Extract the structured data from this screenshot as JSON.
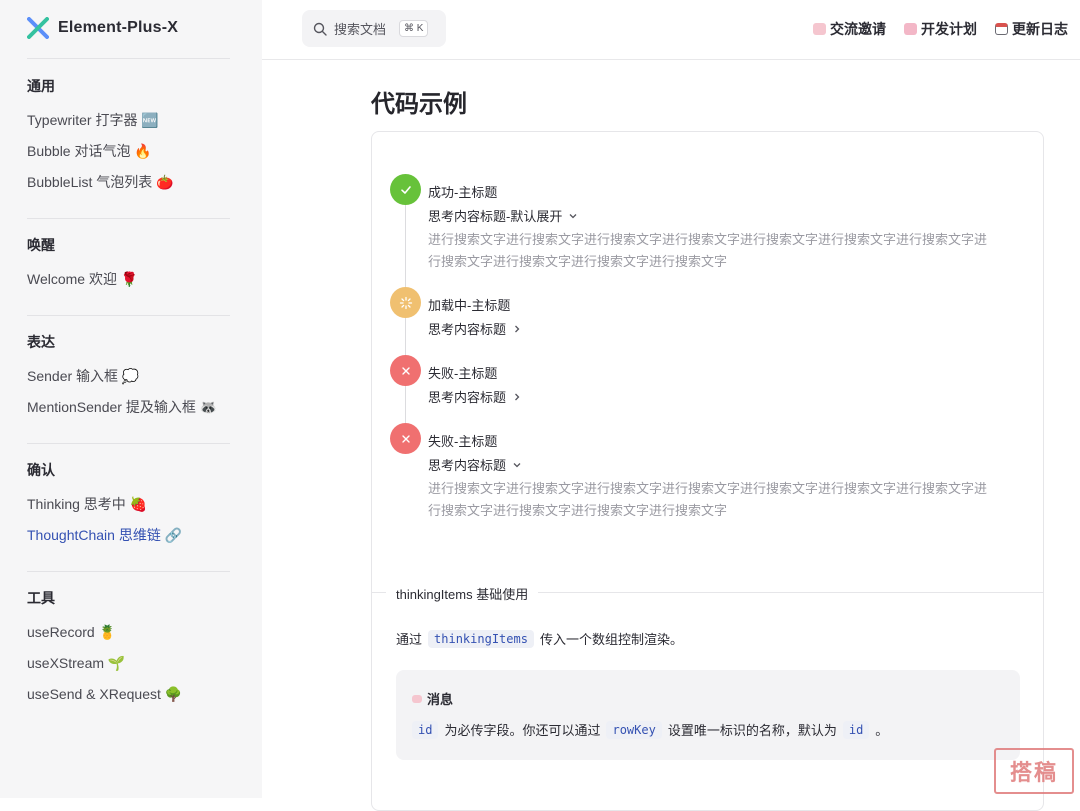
{
  "brand": {
    "name": "Element-Plus-X"
  },
  "sidebar": {
    "groups": [
      {
        "title": "通用",
        "items": [
          {
            "label": "Typewriter 打字器 🆕"
          },
          {
            "label": "Bubble 对话气泡 🔥"
          },
          {
            "label": "BubbleList 气泡列表 🍅"
          }
        ]
      },
      {
        "title": "唤醒",
        "items": [
          {
            "label": "Welcome 欢迎 🌹"
          }
        ]
      },
      {
        "title": "表达",
        "items": [
          {
            "label": "Sender 输入框 💭"
          },
          {
            "label": "MentionSender 提及输入框 🦝"
          }
        ]
      },
      {
        "title": "确认",
        "items": [
          {
            "label": "Thinking 思考中 🍓"
          },
          {
            "label": "ThoughtChain 思维链 🔗"
          }
        ]
      },
      {
        "title": "工具",
        "items": [
          {
            "label": "useRecord 🍍"
          },
          {
            "label": "useXStream 🌱"
          },
          {
            "label": "useSend & XRequest 🌳"
          }
        ]
      }
    ]
  },
  "topbar": {
    "search": {
      "label": "搜索文档",
      "shortcut": "⌘ K"
    },
    "links": [
      {
        "label": "交流邀请",
        "icon": "heart-letter-icon",
        "color": "#e05a6b"
      },
      {
        "label": "开发计划",
        "icon": "ribbon-icon",
        "color": "#e58aa0"
      },
      {
        "label": "更新日志",
        "icon": "calendar-icon",
        "color": "#6b6b73"
      }
    ]
  },
  "main": {
    "title": "代码示例",
    "colors": {
      "success": "#67c23a",
      "loading": "#f0c070",
      "error": "#f07070",
      "accent": "#3451b2"
    },
    "chain": [
      {
        "status": "success",
        "title": "成功-主标题",
        "subtitle": "思考内容标题-默认展开",
        "expanded": true,
        "content": "进行搜索文字进行搜索文字进行搜索文字进行搜索文字进行搜索文字进行搜索文字进行搜索文字进行搜索文字进行搜索文字进行搜索文字进行搜索文字"
      },
      {
        "status": "loading",
        "title": "加载中-主标题",
        "subtitle": "思考内容标题",
        "expanded": false,
        "content": ""
      },
      {
        "status": "error",
        "title": "失败-主标题",
        "subtitle": "思考内容标题",
        "expanded": false,
        "content": ""
      },
      {
        "status": "error",
        "title": "失败-主标题",
        "subtitle": "思考内容标题",
        "expanded": true,
        "content": "进行搜索文字进行搜索文字进行搜索文字进行搜索文字进行搜索文字进行搜索文字进行搜索文字进行搜索文字进行搜索文字进行搜索文字进行搜索文字"
      }
    ],
    "section_title": "thinkingItems 基础使用",
    "desc": {
      "prefix": "通过",
      "code": "thinkingItems",
      "suffix": "传入一个数组控制渲染。"
    },
    "tip": {
      "title": "消息",
      "code1": "id",
      "text1": "为必传字段。你还可以通过",
      "code2": "rowKey",
      "text2": "设置唯一标识的名称，默认为",
      "code3": "id",
      "text3": "。"
    }
  },
  "watermark": {
    "text": "搭稿"
  }
}
